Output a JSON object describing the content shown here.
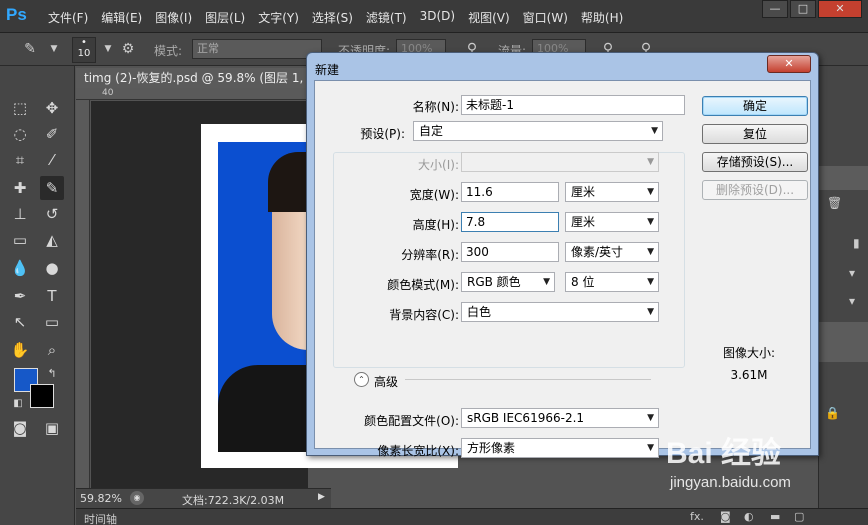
{
  "app": {
    "logo": "Ps",
    "menu": [
      "文件(F)",
      "编辑(E)",
      "图像(I)",
      "图层(L)",
      "文字(Y)",
      "选择(S)",
      "滤镜(T)",
      "3D(D)",
      "视图(V)",
      "窗口(W)",
      "帮助(H)"
    ],
    "window_controls": [
      "—",
      "□",
      "✕"
    ]
  },
  "options_bar": {
    "brush_size": "10",
    "mode_label": "模式:",
    "mode_value": "正常",
    "opacity_label": "不透明度:",
    "opacity_value": "100%",
    "flow_label": "流量:",
    "flow_value": "100%"
  },
  "document": {
    "tab_title": "timg (2)-恢复的.psd @ 59.8% (图层 1, RG",
    "ruler_mark": "40",
    "zoom": "59.82%",
    "doc_info": "文档:722.3K/2.03M",
    "timeline_label": "时间轴"
  },
  "dialog": {
    "title": "新建",
    "close_label": "✕",
    "name_label": "名称(N):",
    "name_value": "未标题-1",
    "preset_label": "预设(P):",
    "preset_value": "自定",
    "size_label": "大小(I):",
    "size_value": "",
    "width_label": "宽度(W):",
    "width_value": "11.6",
    "width_unit": "厘米",
    "height_label": "高度(H):",
    "height_value": "7.8",
    "height_unit": "厘米",
    "resolution_label": "分辨率(R):",
    "resolution_value": "300",
    "resolution_unit": "像素/英寸",
    "color_mode_label": "颜色模式(M):",
    "color_mode_value": "RGB 颜色",
    "bit_depth_value": "8 位",
    "background_label": "背景内容(C):",
    "background_value": "白色",
    "advanced_label": "高级",
    "profile_label": "颜色配置文件(O):",
    "profile_value": "sRGB IEC61966-2.1",
    "pixel_aspect_label": "像素长宽比(X):",
    "pixel_aspect_value": "方形像素",
    "ok_label": "确定",
    "reset_label": "复位",
    "save_preset_label": "存储预设(S)...",
    "delete_preset_label": "删除预设(D)...",
    "image_size_label": "图像大小:",
    "image_size_value": "3.61M"
  },
  "watermark": {
    "logo": "Bai 经验",
    "url": "jingyan.baidu.com"
  },
  "colors": {
    "foreground": "#1658c8",
    "background": "#000000",
    "dialog_frame": "#aac4e6"
  }
}
